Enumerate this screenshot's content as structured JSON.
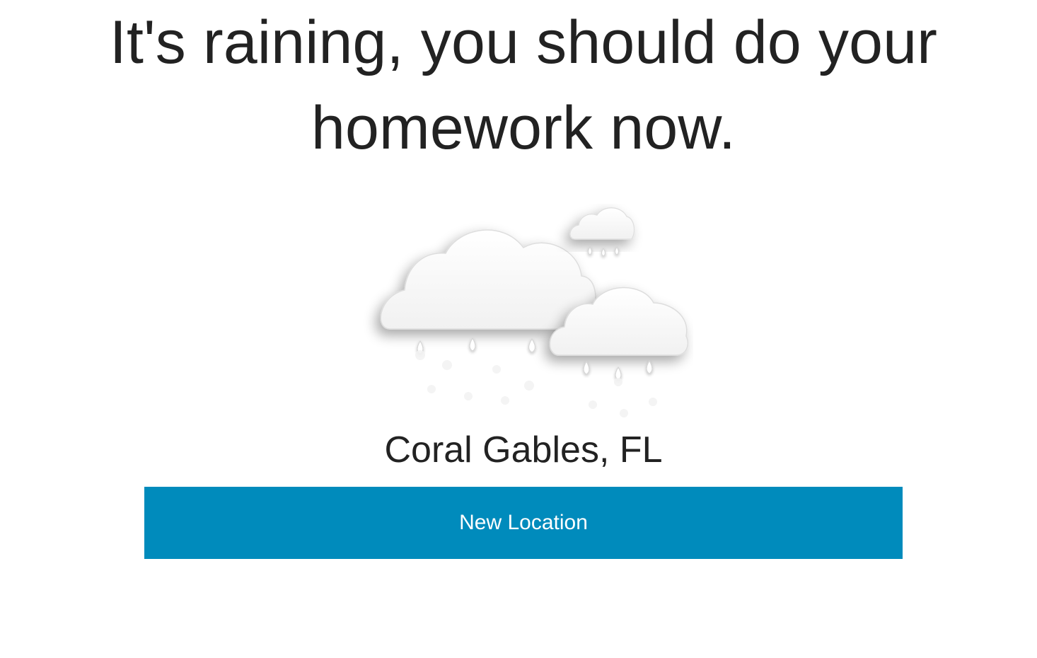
{
  "message": {
    "text": "It's raining, you should do your homework now."
  },
  "weather": {
    "condition_icon": "rain-clouds-icon"
  },
  "location": {
    "name": "Coral Gables, FL"
  },
  "actions": {
    "new_location_label": "New Location",
    "button_color": "#008bbc"
  }
}
